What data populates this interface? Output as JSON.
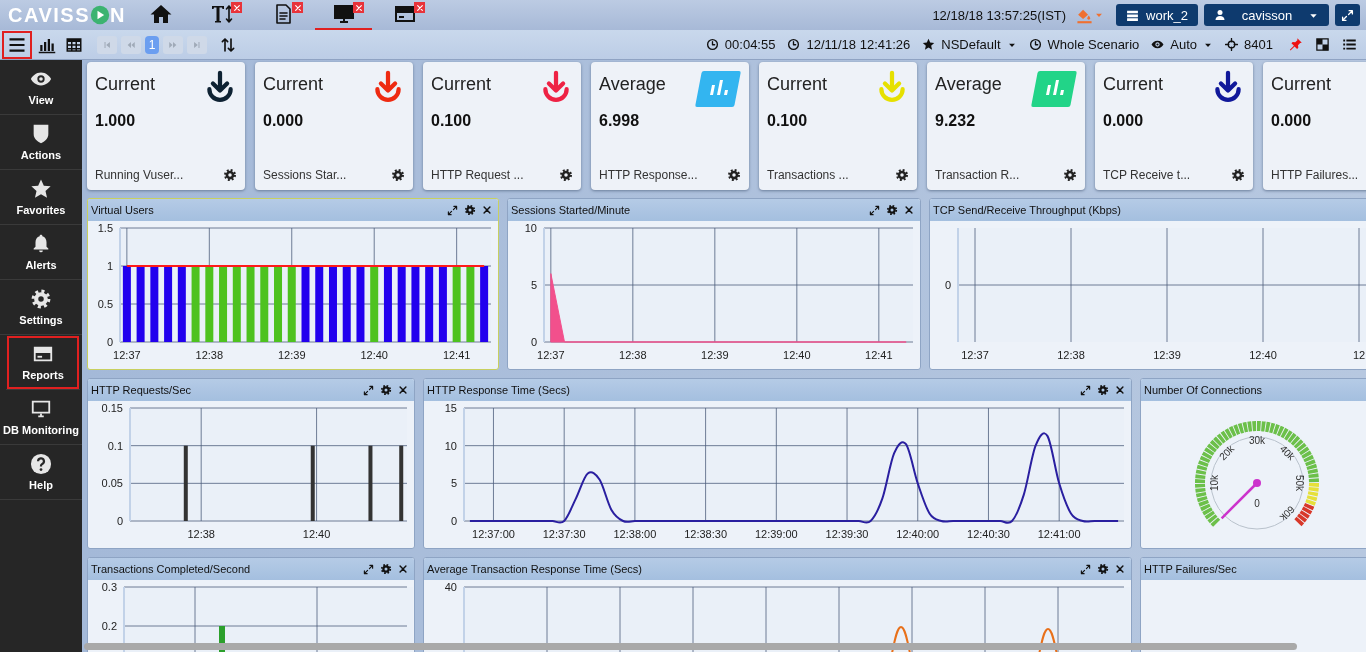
{
  "header": {
    "logo": {
      "before": "CAVISS",
      "after": "N"
    },
    "tabs": [
      {
        "kind": "home",
        "selected": false,
        "closable": false
      },
      {
        "kind": "text",
        "selected": false,
        "closable": true
      },
      {
        "kind": "report",
        "selected": false,
        "closable": true
      },
      {
        "kind": "monitor",
        "selected": true,
        "closable": true
      },
      {
        "kind": "card",
        "selected": false,
        "closable": true
      }
    ],
    "datetime": "12/18/18 13:57:25(IST)",
    "workspace": "work_2",
    "user": "cavisson"
  },
  "toolbar": {
    "menu_selected": true,
    "page": "1",
    "items": [
      {
        "kind": "clock",
        "text": "00:04:55",
        "dropdown": false
      },
      {
        "kind": "clock",
        "text": "12/11/18 12:41:26",
        "dropdown": false
      },
      {
        "kind": "star",
        "text": "NSDefault",
        "dropdown": true
      },
      {
        "kind": "clock",
        "text": "Whole Scenario",
        "dropdown": false
      },
      {
        "kind": "eye",
        "text": "Auto",
        "dropdown": true
      },
      {
        "kind": "crosshair",
        "text": "8401",
        "dropdown": false
      }
    ]
  },
  "sidebar": {
    "items": [
      {
        "kind": "eye",
        "label": "View",
        "selected": false
      },
      {
        "kind": "shield",
        "label": "Actions",
        "selected": false
      },
      {
        "kind": "star",
        "label": "Favorites",
        "selected": false
      },
      {
        "kind": "bell",
        "label": "Alerts",
        "selected": false
      },
      {
        "kind": "gear",
        "label": "Settings",
        "selected": false
      },
      {
        "kind": "card",
        "label": "Reports",
        "selected": true
      },
      {
        "kind": "monitor",
        "label": "DB Monitoring",
        "selected": false
      },
      {
        "kind": "help",
        "label": "Help",
        "selected": false
      }
    ]
  },
  "cards": [
    {
      "stat": "Current",
      "value": "1.000",
      "name": "Running Vuser...",
      "kind": "arrow",
      "color": "#0e2233",
      "gear": true
    },
    {
      "stat": "Current",
      "value": "0.000",
      "name": "Sessions Star...",
      "kind": "arrow",
      "color": "#ee2a11",
      "gear": true
    },
    {
      "stat": "Current",
      "value": "0.100",
      "name": "HTTP Request ...",
      "kind": "arrow",
      "color": "#ee2244",
      "gear": true
    },
    {
      "stat": "Average",
      "value": "6.998",
      "name": "HTTP Response...",
      "kind": "bars",
      "color": "#33b5f0",
      "gear": true
    },
    {
      "stat": "Current",
      "value": "0.100",
      "name": "Transactions ...",
      "kind": "arrow",
      "color": "#e6e000",
      "gear": true
    },
    {
      "stat": "Average",
      "value": "9.232",
      "name": "Transaction R...",
      "kind": "bars",
      "color": "#22d488",
      "gear": true
    },
    {
      "stat": "Current",
      "value": "0.000",
      "name": "TCP Receive t...",
      "kind": "arrow",
      "color": "#10189a",
      "gear": true
    },
    {
      "stat": "Current",
      "value": "0.000",
      "name": "HTTP Failures...",
      "kind": "none",
      "gear": false
    }
  ],
  "panel_rows": [
    [
      {
        "title": "Virtual Users",
        "selected": true,
        "tools": true,
        "kind": "chart",
        "chart_data": {
          "type": "bar",
          "categories": [
            "12:37",
            null,
            null,
            null,
            null,
            null,
            "12:38",
            null,
            null,
            null,
            null,
            null,
            "12:39",
            null,
            null,
            null,
            null,
            null,
            "12:40",
            null,
            null,
            null,
            null,
            null,
            "12:41",
            null,
            null
          ],
          "grid": true,
          "ylim": [
            0,
            1.5
          ],
          "yticks": [
            0,
            0.5,
            1,
            1.5
          ],
          "series": [
            {
              "color": "#2200ee",
              "values": [
                1,
                1,
                1,
                1,
                1,
                null,
                null,
                null,
                null,
                null,
                null,
                null,
                null,
                1,
                1,
                1,
                1,
                1,
                null,
                1,
                1,
                1,
                1,
                1,
                null,
                null,
                1
              ]
            },
            {
              "color": "#4ec21f",
              "values": [
                null,
                null,
                null,
                null,
                null,
                1,
                1,
                1,
                1,
                1,
                1,
                1,
                1,
                null,
                null,
                null,
                null,
                null,
                1,
                null,
                null,
                null,
                null,
                null,
                1,
                1,
                null
              ]
            },
            {
              "type": "line",
              "color": "#ff1a1a",
              "values": [
                1,
                1,
                1,
                1,
                1,
                1,
                1,
                1,
                1,
                1,
                1,
                1,
                1,
                1,
                1,
                1,
                1,
                1,
                1,
                1,
                1,
                1,
                1,
                1,
                1,
                1,
                1
              ]
            }
          ]
        }
      },
      {
        "title": "Sessions Started/Minute",
        "selected": false,
        "tools": true,
        "kind": "chart",
        "chart_data": {
          "type": "area",
          "categories": [
            "12:37",
            null,
            null,
            null,
            null,
            null,
            "12:38",
            null,
            null,
            null,
            null,
            null,
            "12:39",
            null,
            null,
            null,
            null,
            null,
            "12:40",
            null,
            null,
            null,
            null,
            null,
            "12:41",
            null,
            null
          ],
          "grid": true,
          "ylim": [
            0,
            10
          ],
          "yticks": [
            0,
            5,
            10
          ],
          "series": [
            {
              "color": "#f2508c",
              "values": [
                6,
                0,
                0,
                0,
                0,
                0,
                0,
                0,
                0,
                0,
                0,
                0,
                0,
                0,
                0,
                0,
                0,
                0,
                0,
                0,
                0,
                0,
                0,
                0,
                0,
                0,
                0
              ]
            }
          ]
        }
      },
      {
        "title": "TCP Send/Receive Throughput (Kbps)",
        "selected": false,
        "tools": false,
        "kind": "blank",
        "axes": {
          "y_labels": [
            "0"
          ],
          "x_labels": [
            "12:37",
            "12:38",
            "12:39",
            "12:40",
            "12"
          ]
        }
      }
    ],
    [
      {
        "title": "HTTP Requests/Sec",
        "selected": false,
        "tools": true,
        "kind": "chart",
        "chart_data": {
          "type": "bar",
          "categories": [
            null,
            null,
            null,
            null,
            null,
            null,
            null,
            null,
            null,
            null,
            null,
            null,
            null,
            null,
            null,
            null,
            null,
            null,
            "12:38",
            null,
            null,
            null,
            null,
            null,
            null,
            null,
            null,
            null,
            null,
            null,
            null,
            null,
            null,
            null,
            null,
            null,
            null,
            null,
            null,
            null,
            null,
            null,
            null,
            null,
            null,
            null,
            null,
            null,
            "12:40",
            null,
            null,
            null,
            null,
            null,
            null,
            null,
            null,
            null,
            null,
            null,
            null,
            null,
            null,
            null,
            null,
            null,
            null,
            null,
            null,
            null,
            null,
            null
          ],
          "grid": true,
          "ylim": [
            0,
            0.15
          ],
          "yticks": [
            0,
            0.05,
            0.1,
            0.15
          ],
          "series": [
            {
              "color": "#333333",
              "values": [
                null,
                null,
                null,
                null,
                null,
                null,
                null,
                null,
                null,
                null,
                null,
                null,
                null,
                null,
                0.1,
                null,
                null,
                null,
                null,
                null,
                null,
                null,
                null,
                null,
                null,
                null,
                null,
                null,
                null,
                null,
                null,
                null,
                null,
                null,
                null,
                null,
                null,
                null,
                null,
                null,
                null,
                null,
                null,
                null,
                null,
                null,
                null,
                0.1,
                null,
                null,
                null,
                null,
                null,
                null,
                null,
                null,
                null,
                null,
                null,
                null,
                null,
                null,
                0.1,
                null,
                null,
                null,
                null,
                null,
                null,
                null,
                0.1,
                null
              ]
            }
          ]
        }
      },
      {
        "title": "HTTP Response Time (Secs)",
        "selected": false,
        "tools": true,
        "kind": "chart",
        "chart_data": {
          "type": "line",
          "categories": [
            null,
            null,
            "12:37:00",
            null,
            null,
            null,
            null,
            null,
            "12:37:30",
            null,
            null,
            null,
            null,
            null,
            "12:38:00",
            null,
            null,
            null,
            null,
            null,
            "12:38:30",
            null,
            null,
            null,
            null,
            null,
            "12:39:00",
            null,
            null,
            null,
            null,
            null,
            "12:39:30",
            null,
            null,
            null,
            null,
            null,
            "12:40:00",
            null,
            null,
            null,
            null,
            null,
            "12:40:30",
            null,
            null,
            null,
            null,
            null,
            "12:41:00",
            null,
            null,
            null,
            null,
            null
          ],
          "grid": true,
          "ylim": [
            0,
            15
          ],
          "yticks": [
            0,
            5,
            10,
            15
          ],
          "series": [
            {
              "color": "#2a1fa0",
              "values": [
                0,
                0,
                0,
                0,
                0,
                0,
                0,
                0,
                0,
                3,
                6.3,
                5.5,
                1.5,
                0,
                0,
                0,
                0,
                0,
                0,
                0,
                0,
                0,
                0,
                0,
                0,
                0,
                0,
                0,
                0,
                0,
                0,
                0,
                0,
                0,
                0,
                3,
                9,
                10.2,
                5,
                1,
                0,
                0,
                0,
                0,
                0,
                0,
                0,
                3.5,
                10,
                11.3,
                5,
                1,
                0,
                0,
                0,
                0
              ]
            }
          ]
        }
      },
      {
        "title": "Number Of Connections",
        "selected": false,
        "tools": false,
        "kind": "gauge",
        "gauge": {
          "labels": [
            "10k",
            "20k",
            "30k",
            "40k",
            "50k",
            "60k"
          ],
          "reading": "0"
        }
      }
    ],
    [
      {
        "title": "Transactions Completed/Second",
        "selected": false,
        "tools": true,
        "kind": "blank",
        "axes": {
          "y_labels": [
            "0.3",
            "0.2"
          ]
        },
        "bar": true
      },
      {
        "title": "Average Transaction Response Time (Secs)",
        "selected": false,
        "tools": true,
        "kind": "blank",
        "axes": {
          "y_labels": [
            "40"
          ]
        },
        "trace": true
      },
      {
        "title": "HTTP Failures/Sec",
        "selected": false,
        "tools": false,
        "kind": "empty"
      }
    ]
  ]
}
